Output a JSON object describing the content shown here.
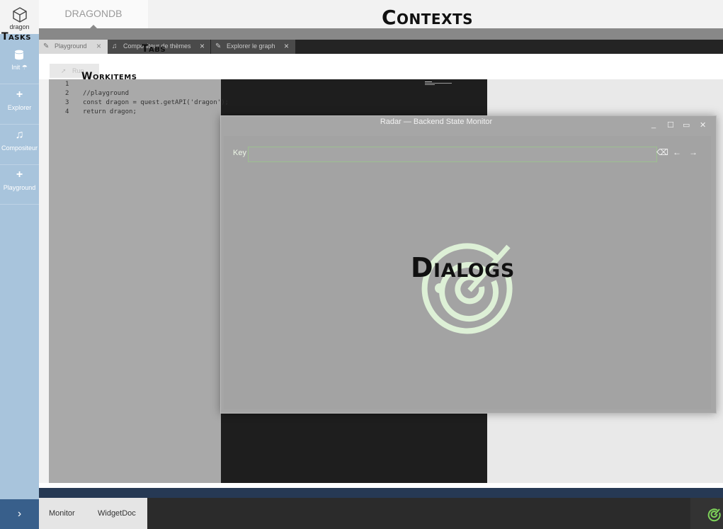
{
  "app": {
    "logo_text": "dragon"
  },
  "overlay_labels": {
    "tasks": "Tasks",
    "contexts": "Contexts",
    "tabs": "Tabs",
    "workitems": "Workitems",
    "dialogs": "Dialogs"
  },
  "sidebar": {
    "items": [
      {
        "label": "Init",
        "icon": "database-icon"
      },
      {
        "label": "Explorer",
        "icon": "plus-icon"
      },
      {
        "label": "Compositeur",
        "icon": "music-icon"
      },
      {
        "label": "Playground",
        "icon": "plus-icon"
      }
    ],
    "expand_icon": "chevron-right-icon"
  },
  "contexts": {
    "active": "DRAGONDB"
  },
  "tabs": [
    {
      "label": "Playground",
      "icon": "pencil-icon",
      "active": true
    },
    {
      "label": "Compositeur de thèmes",
      "icon": "music-icon",
      "active": false
    },
    {
      "label": "Explorer le graph",
      "icon": "pencil-icon",
      "active": false
    }
  ],
  "workitem": {
    "run_label": "Run",
    "line_numbers": [
      "1",
      "2",
      "3",
      "4"
    ],
    "code_lines": [
      "",
      "//playground",
      "const dragon = quest.getAPI('dragon');",
      "return dragon;"
    ]
  },
  "dialog": {
    "title": "Radar — Backend State Monitor",
    "key_label": "Key",
    "key_value": "",
    "accent_color": "#ddf0d6"
  },
  "footer": {
    "items": [
      "Monitor",
      "WidgetDoc"
    ],
    "status_icon": "radar-icon",
    "status_color": "#7ed35a"
  },
  "colors": {
    "sidebar": "#a8c4dc",
    "dialog_overlay": "#a6a6a6",
    "editor_bg": "#1e1e1e"
  }
}
